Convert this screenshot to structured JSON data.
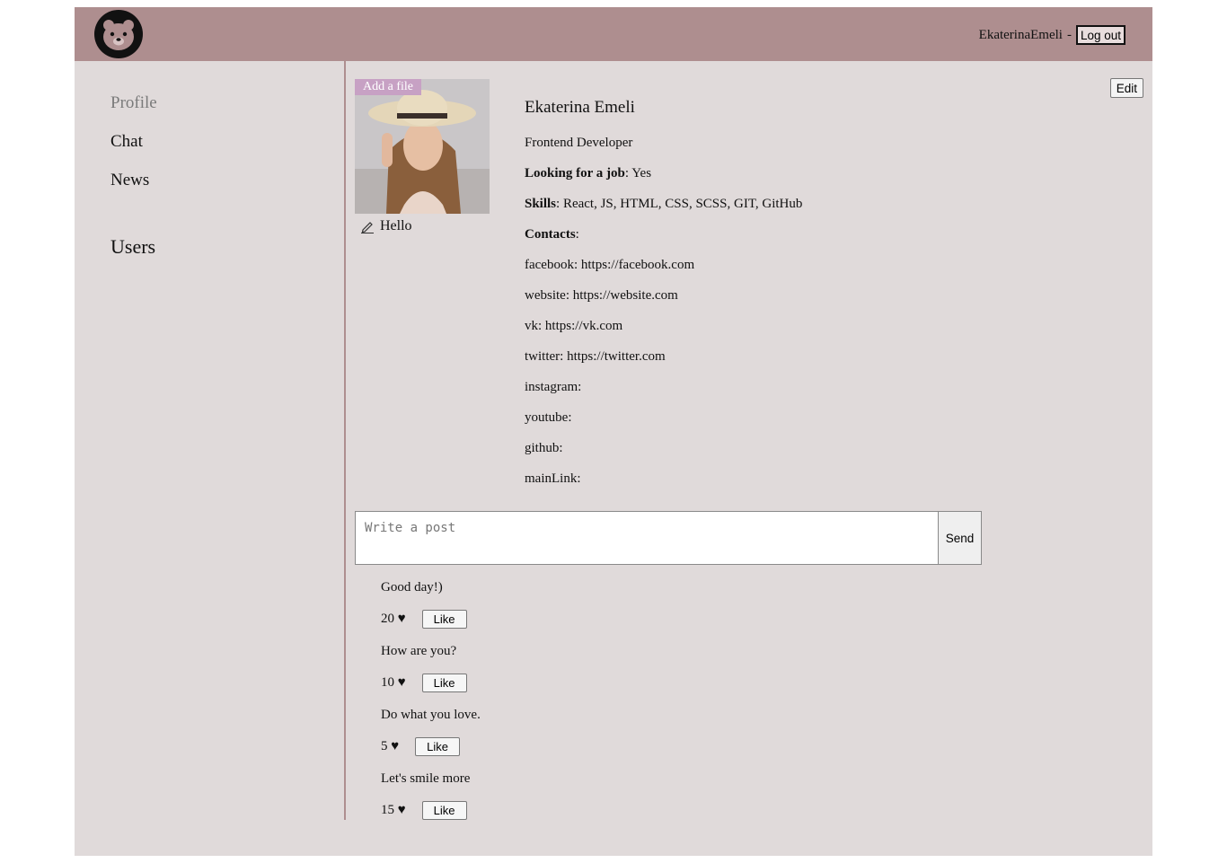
{
  "header": {
    "login": "EkaterinaEmeli",
    "separator": "-",
    "logout_label": "Log out"
  },
  "sidebar": {
    "items": [
      {
        "label": "Profile"
      },
      {
        "label": "Chat"
      },
      {
        "label": "News"
      }
    ],
    "users_label": "Users"
  },
  "profile": {
    "add_file_label": "Add a file",
    "status": "Hello",
    "edit_label": "Edit",
    "full_name": "Ekaterina Emeli",
    "about_me": "Frontend Developer",
    "looking_label": "Looking for a job",
    "looking_value": "Yes",
    "skills_label": "Skills",
    "skills_value": "React, JS, HTML, CSS, SCSS, GIT, GitHub",
    "contacts_label": "Contacts",
    "contacts": [
      {
        "key": "facebook",
        "value": "https://facebook.com"
      },
      {
        "key": "website",
        "value": "https://website.com"
      },
      {
        "key": "vk",
        "value": "https://vk.com"
      },
      {
        "key": "twitter",
        "value": "https://twitter.com"
      },
      {
        "key": "instagram",
        "value": ""
      },
      {
        "key": "youtube",
        "value": ""
      },
      {
        "key": "github",
        "value": ""
      },
      {
        "key": "mainLink",
        "value": ""
      }
    ]
  },
  "post_form": {
    "placeholder": "Write a post",
    "send_label": "Send"
  },
  "posts": [
    {
      "text": "Good day!)",
      "likes": "20",
      "like_label": "Like"
    },
    {
      "text": "How are you?",
      "likes": "10",
      "like_label": "Like"
    },
    {
      "text": "Do what you love.",
      "likes": "5",
      "like_label": "Like"
    },
    {
      "text": "Let's smile more",
      "likes": "15",
      "like_label": "Like"
    }
  ],
  "colors": {
    "header_bg": "#ae8e8f",
    "page_bg": "#e0dada",
    "add_file_bg": "#c7a1c4"
  }
}
